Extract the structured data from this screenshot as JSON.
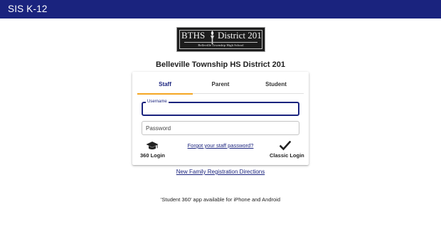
{
  "header": {
    "title": "SIS K-12"
  },
  "logo": {
    "left_text": "BTHS",
    "right_text": "District 201",
    "subtitle": "Belleville Township High School"
  },
  "district_name": "Belleville Township HS District 201",
  "tabs": [
    {
      "label": "Staff",
      "active": true
    },
    {
      "label": "Parent",
      "active": false
    },
    {
      "label": "Student",
      "active": false
    }
  ],
  "form": {
    "username": {
      "label": "Username",
      "value": ""
    },
    "password": {
      "label": "Password",
      "value": ""
    }
  },
  "actions": {
    "login_360": {
      "label": "360 Login",
      "icon": "graduation-cap-icon"
    },
    "forgot_password": "Forgot your staff password?",
    "classic_login": {
      "label": "Classic Login",
      "icon": "checkmark-icon"
    }
  },
  "links": {
    "new_family": "New Family Registration Directions"
  },
  "footer_note": "'Student 360' app available for iPhone and Android",
  "colors": {
    "primary": "#1a237e",
    "tab_indicator": "#f5a623"
  }
}
